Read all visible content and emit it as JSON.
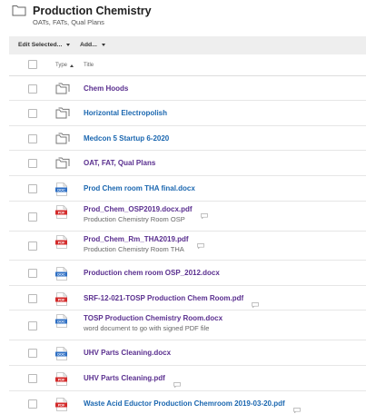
{
  "header": {
    "title": "Production Chemistry",
    "subtitle": "OATs, FATs, Qual Plans"
  },
  "toolbar": {
    "edit_selected_label": "Edit Selected...",
    "add_label": "Add..."
  },
  "columns": {
    "type_label": "Type",
    "title_label": "Title"
  },
  "colors": {
    "folder_link": "#5a2f8f",
    "file_link": "#1b67b0",
    "pdf_red": "#d32b2b",
    "docx_blue": "#2e6fc4",
    "toolbar_bg": "#eeeeee"
  },
  "rows": [
    {
      "name": "Chem Hoods",
      "icon": "folder-icon",
      "color": "#5a2f8f"
    },
    {
      "name": "Horizontal Electropolish",
      "icon": "folder-icon",
      "color": "#1b67b0"
    },
    {
      "name": "Medcon 5 Startup 6-2020",
      "icon": "folder-icon",
      "color": "#1b67b0"
    },
    {
      "name": "OAT, FAT, Qual Plans",
      "icon": "folder-icon",
      "color": "#5a2f8f"
    },
    {
      "name": "Prod Chem room THA final.docx",
      "icon": "docx-icon",
      "color": "#1b67b0"
    },
    {
      "name": "Prod_Chem_OSP2019.docx.pdf",
      "icon": "pdf-icon",
      "color": "#5a2f8f",
      "desc": "Production Chemistry Room OSP",
      "comment": true
    },
    {
      "name": "Prod_Chem_Rm_THA2019.pdf",
      "icon": "pdf-icon",
      "color": "#5a2f8f",
      "desc": "Production Chemistry Room THA",
      "comment": true
    },
    {
      "name": "Production chem room OSP_2012.docx",
      "icon": "docx-icon",
      "color": "#5a2f8f"
    },
    {
      "name": "SRF-12-021-TOSP Production Chem Room.pdf",
      "icon": "pdf-icon",
      "color": "#5a2f8f",
      "comment": true
    },
    {
      "name": "TOSP Production Chemistry Room.docx",
      "icon": "docx-icon",
      "color": "#5a2f8f",
      "desc": "word document to go with signed PDF file"
    },
    {
      "name": "UHV Parts Cleaning.docx",
      "icon": "docx-icon",
      "color": "#5a2f8f"
    },
    {
      "name": "UHV Parts Cleaning.pdf",
      "icon": "pdf-icon",
      "color": "#5a2f8f",
      "comment": true
    },
    {
      "name": "Waste Acid Eductor Production Chemroom 2019-03-20.pdf",
      "icon": "pdf-icon",
      "color": "#1b67b0",
      "comment": true
    }
  ]
}
